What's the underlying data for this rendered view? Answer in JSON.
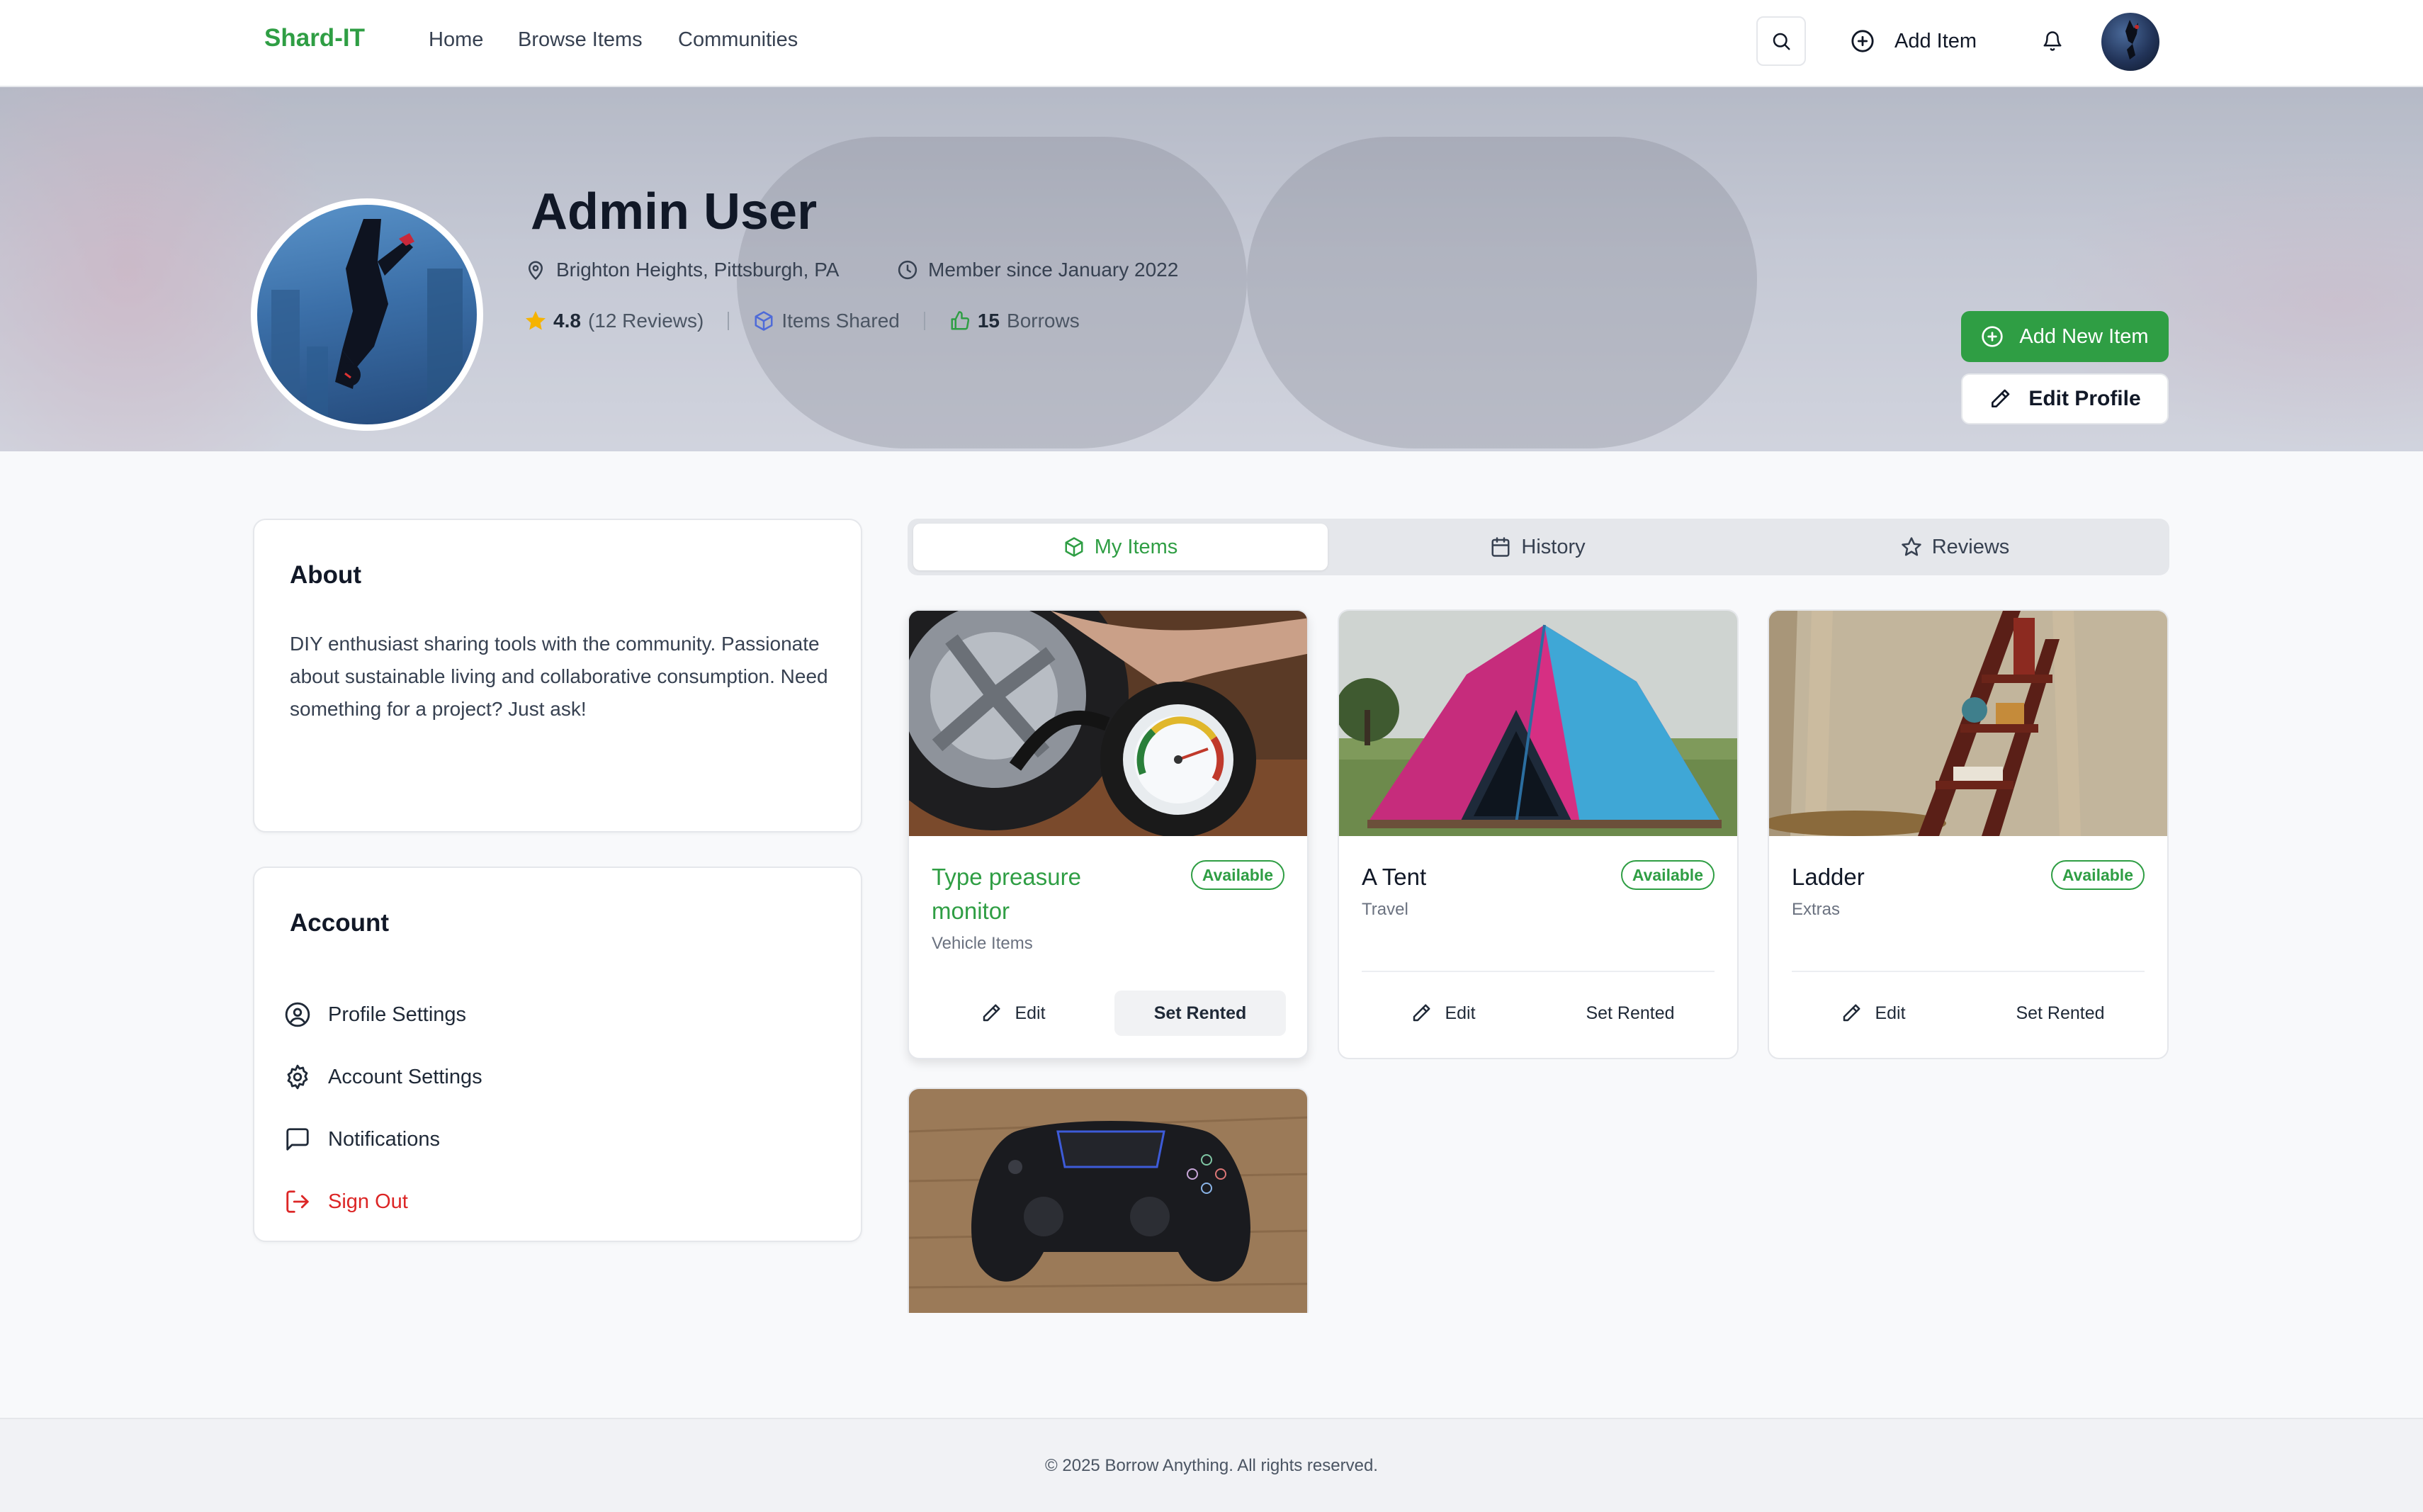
{
  "nav": {
    "brand": "Shard-IT",
    "links": [
      "Home",
      "Browse Items",
      "Communities"
    ],
    "add_item_label": "Add Item",
    "icons": {
      "search": "search-icon",
      "add": "plus-circle-icon",
      "bell": "bell-icon"
    }
  },
  "profile": {
    "name": "Admin User",
    "location": "Brighton Heights, Pittsburgh, PA",
    "member_since": "Member since January 2022",
    "rating": "4.8",
    "reviews": "(12 Reviews)",
    "items_shared": "Items Shared",
    "borrows_count": "15",
    "borrows_label": "Borrows",
    "add_new_item": "Add New Item",
    "edit_profile": "Edit Profile"
  },
  "about": {
    "title": "About",
    "text": "DIY enthusiast sharing tools with the community. Passionate about sustainable living and collaborative consumption. Need something for a project? Just ask!"
  },
  "account": {
    "title": "Account",
    "items": [
      {
        "label": "Profile Settings",
        "icon": "user-circle-icon"
      },
      {
        "label": "Account Settings",
        "icon": "gear-icon"
      },
      {
        "label": "Notifications",
        "icon": "message-square-icon"
      },
      {
        "label": "Sign Out",
        "icon": "logout-icon"
      }
    ]
  },
  "tabs": [
    {
      "label": "My Items",
      "icon": "package-icon",
      "active": true
    },
    {
      "label": "History",
      "icon": "calendar-icon",
      "active": false
    },
    {
      "label": "Reviews",
      "icon": "star-icon",
      "active": false
    }
  ],
  "items": [
    {
      "title": "Type preasure monitor",
      "category": "Vehicle Items",
      "status": "Available",
      "edit": "Edit",
      "rent": "Set Rented",
      "image": "tire-pressure-gauge"
    },
    {
      "title": "A Tent",
      "category": "Travel",
      "status": "Available",
      "edit": "Edit",
      "rent": "Set Rented",
      "image": "camping-tent"
    },
    {
      "title": "Ladder",
      "category": "Extras",
      "status": "Available",
      "edit": "Edit",
      "rent": "Set Rented",
      "image": "wooden-ladder-shelf"
    },
    {
      "image": "game-controller"
    }
  ],
  "colors": {
    "accent": "#2f9e44",
    "danger": "#dc2626",
    "rating_star": "#f5b301",
    "items_shared_icon": "#4f6bd8"
  },
  "footer": {
    "text": "© 2025 Borrow Anything. All rights reserved."
  }
}
